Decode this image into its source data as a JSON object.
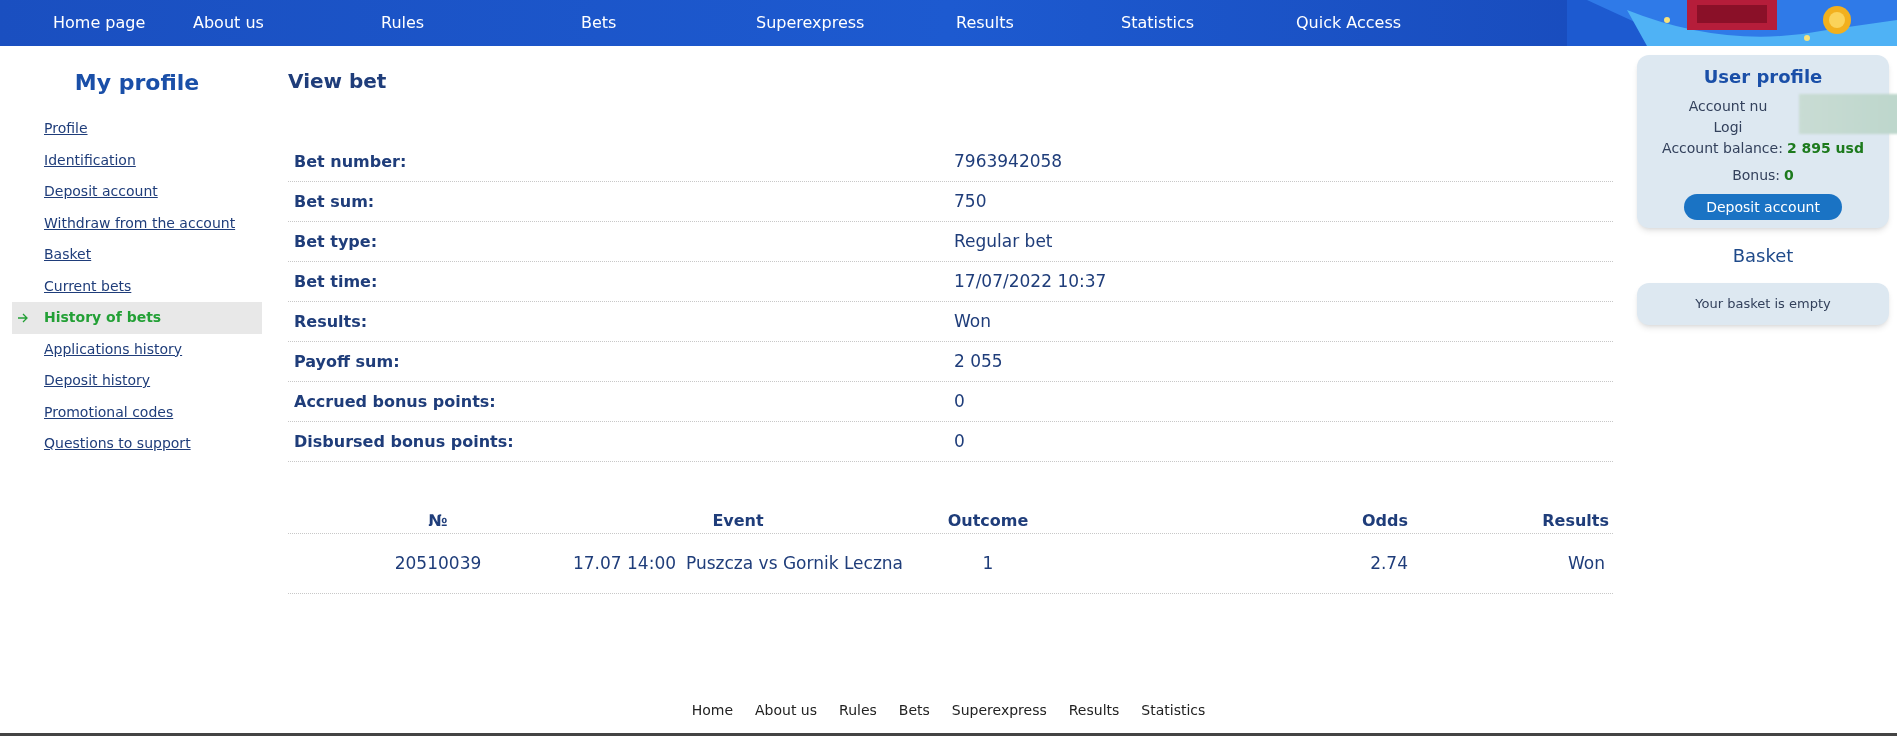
{
  "nav": [
    {
      "label": "Home page"
    },
    {
      "label": "About us"
    },
    {
      "label": "Rules"
    },
    {
      "label": "Bets"
    },
    {
      "label": "Superexpress"
    },
    {
      "label": "Results"
    },
    {
      "label": "Statistics"
    },
    {
      "label": "Quick Access"
    }
  ],
  "sidebar": {
    "title": "My profile",
    "items": [
      {
        "label": "Profile",
        "selected": false
      },
      {
        "label": "Identification",
        "selected": false
      },
      {
        "label": "Deposit account",
        "selected": false
      },
      {
        "label": "Withdraw from the account",
        "selected": false
      },
      {
        "label": "Basket",
        "selected": false
      },
      {
        "label": "Current bets",
        "selected": false
      },
      {
        "label": "History of bets",
        "selected": true
      },
      {
        "label": "Applications history",
        "selected": false
      },
      {
        "label": "Deposit history",
        "selected": false
      },
      {
        "label": "Promotional codes",
        "selected": false
      },
      {
        "label": "Questions to support",
        "selected": false
      }
    ]
  },
  "main": {
    "title": "View bet",
    "details": [
      {
        "label": "Bet number:",
        "value": "7963942058"
      },
      {
        "label": "Bet sum:",
        "value": "750"
      },
      {
        "label": "Bet type:",
        "value": "Regular bet"
      },
      {
        "label": "Bet time:",
        "value": "17/07/2022 10:37"
      },
      {
        "label": "Results:",
        "value": "Won"
      },
      {
        "label": "Payoff sum:",
        "value": "2 055"
      },
      {
        "label": "Accrued bonus points:",
        "value": "0"
      },
      {
        "label": "Disbursed bonus points:",
        "value": "0"
      }
    ],
    "table": {
      "columns": [
        "№",
        "Event",
        "Outcome",
        "Odds",
        "Results"
      ],
      "rows": [
        {
          "number": "20510039",
          "time": "17.07 14:00",
          "event": "Puszcza vs Gornik Leczna",
          "outcome": "1",
          "odds": "2.74",
          "result": "Won"
        }
      ]
    }
  },
  "user_profile": {
    "title": "User profile",
    "account_number_label": "Account nu",
    "login_label": "Logi",
    "balance_label": "Account balance:",
    "balance_value": "2 895 usd",
    "bonus_label": "Bonus:",
    "bonus_value": "0",
    "button": "Deposit account"
  },
  "basket": {
    "title": "Basket",
    "message": "Your basket is empty"
  },
  "footer": [
    {
      "label": "Home"
    },
    {
      "label": "About us"
    },
    {
      "label": "Rules"
    },
    {
      "label": "Bets"
    },
    {
      "label": "Superexpress"
    },
    {
      "label": "Results"
    },
    {
      "label": "Statistics"
    }
  ]
}
